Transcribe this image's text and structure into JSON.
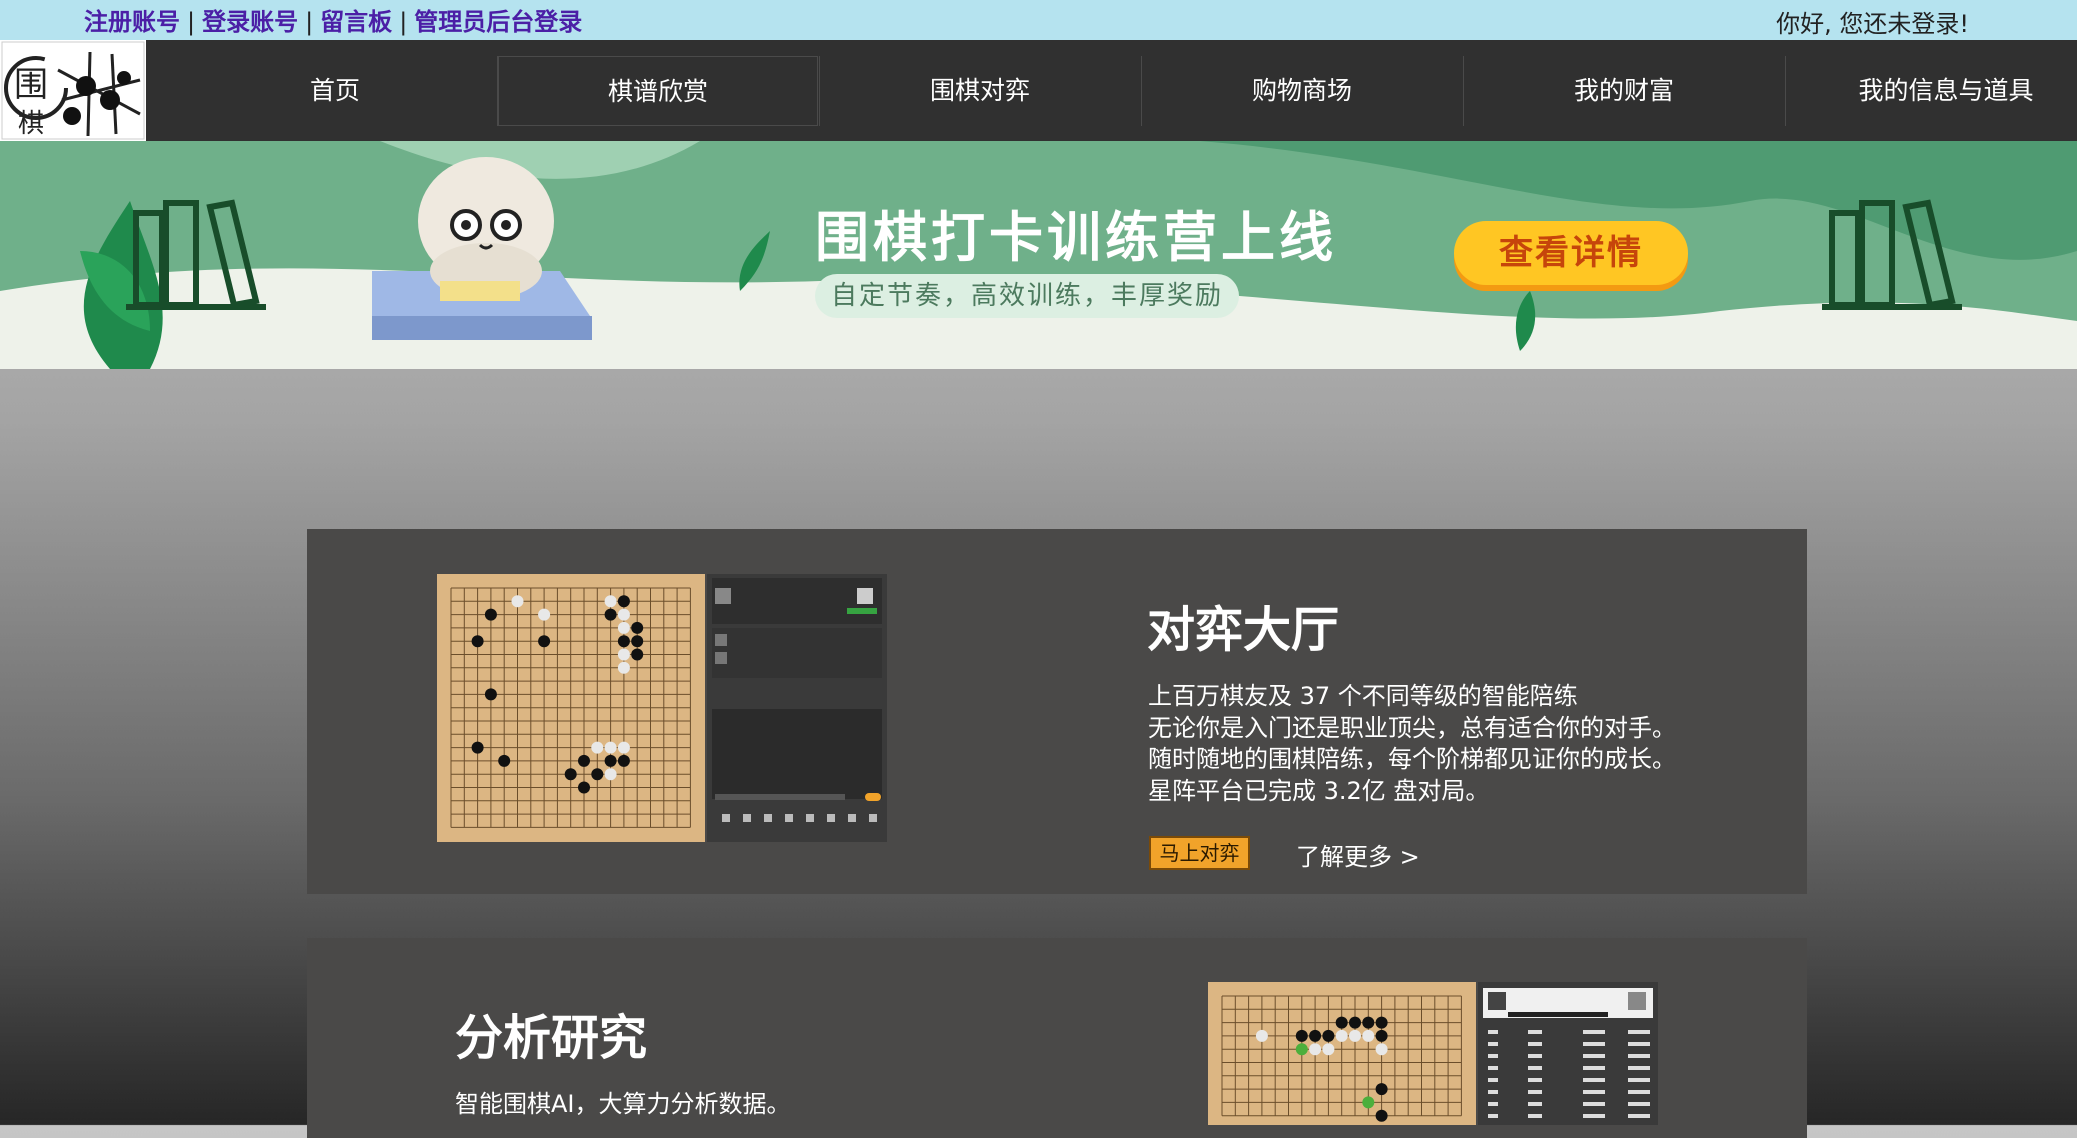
{
  "topbar": {
    "links": [
      "注册账号",
      "登录账号",
      "留言板",
      "管理员后台登录"
    ],
    "greeting": "你好, 您还未登录!"
  },
  "logo": {
    "text_top": "围",
    "text_bottom": "棋"
  },
  "nav": {
    "items": [
      "首页",
      "棋谱欣赏",
      "围棋对弈",
      "购物商场",
      "我的财富",
      "我的信息与道具"
    ],
    "active_index": 1
  },
  "banner": {
    "title": "围棋打卡训练营上线",
    "subtitle": "自定节奏，高效训练，丰厚奖励",
    "button": "查看详情"
  },
  "section1": {
    "title": "对弈大厅",
    "lines": [
      "上百万棋友及 37 个不同等级的智能陪练",
      "无论你是入门还是职业顶尖，总有适合你的对手。",
      "随时随地的围棋陪练，每个阶梯都见证你的成长。",
      "星阵平台已完成 3.2亿 盘对局。"
    ],
    "play_button": "马上对弈",
    "learn_more": "了解更多 >"
  },
  "section2": {
    "title": "分析研究",
    "line": "智能围棋AI，大算力分析数据。"
  },
  "colors": {
    "topbar": "#b5e3ef",
    "link": "#4b1fa6",
    "nav_bg": "#303030",
    "banner_green": "#6fb08a",
    "banner_button": "#ffc623",
    "panel": "#4a4948",
    "board": "#dcb683",
    "play_button": "#f1a32a"
  }
}
